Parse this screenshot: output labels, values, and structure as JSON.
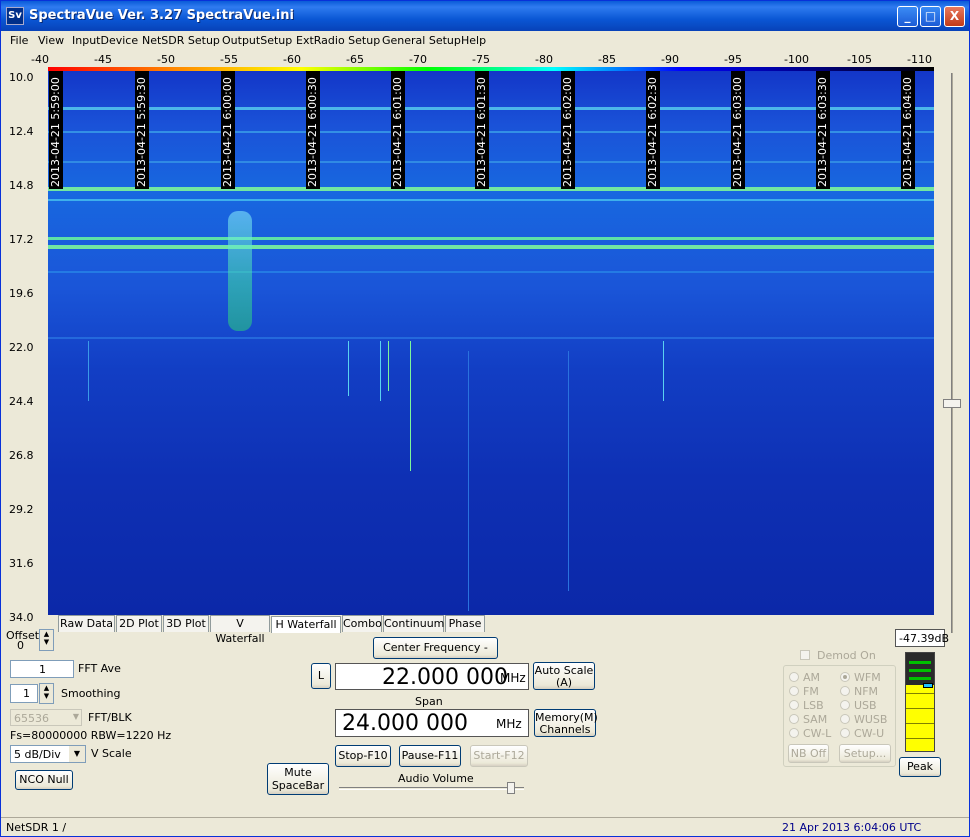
{
  "window": {
    "icon_text": "Sv",
    "title": "SpectraVue Ver. 3.27  SpectraVue.ini",
    "minimize": "_",
    "maximize": "□",
    "close": "X"
  },
  "menu": [
    "File",
    "View",
    "InputDevice",
    "NetSDR Setup",
    "OutputSetup",
    "ExtRadio Setup",
    "General Setup",
    "Help"
  ],
  "db_scale": [
    "-40",
    "-45",
    "-50",
    "-55",
    "-60",
    "-65",
    "-70",
    "-75",
    "-80",
    "-85",
    "-90",
    "-95",
    "-100",
    "-105",
    "-110"
  ],
  "freq_axis": [
    "10.0",
    "12.4",
    "14.8",
    "17.2",
    "19.6",
    "22.0",
    "24.4",
    "26.8",
    "29.2",
    "31.6",
    "34.0"
  ],
  "timestamps": [
    "2013-04-21 5:59:00",
    "2013-04-21 5:59:30",
    "2013-04-21 6:00:00",
    "2013-04-21 6:00:30",
    "2013-04-21 6:01:00",
    "2013-04-21 6:01:30",
    "2013-04-21 6:02:00",
    "2013-04-21 6:02:30",
    "2013-04-21 6:03:00",
    "2013-04-21 6:03:30",
    "2013-04-21 6:04:00"
  ],
  "tabs": [
    "Raw Data",
    "2D Plot",
    "3D Plot",
    "V Waterfall",
    "H Waterfall",
    "Combo",
    "Continuum",
    "Phase"
  ],
  "active_tab": "H Waterfall",
  "left_panel": {
    "offset_label": "Offset",
    "offset_value": "0",
    "fft_ave_value": "1",
    "fft_ave_label": "FFT Ave",
    "smoothing_value": "1",
    "smoothing_label": "Smoothing",
    "fft_blk_value": "65536",
    "fft_blk_label": "FFT/BLK",
    "fs_info": "Fs=80000000 RBW=1220 Hz",
    "vscale_value": "5 dB/Div",
    "vscale_label": "V Scale",
    "nco_null": "NCO Null"
  },
  "center": {
    "mute_line1": "Mute",
    "mute_line2": "SpaceBar",
    "center_freq_button": "Center Frequency - Ins",
    "l_button": "L",
    "center_freq_value": "22.000 000",
    "center_freq_unit": "MHz",
    "auto_scale_line1": "Auto Scale",
    "auto_scale_line2": "(A)",
    "span_label": "Span",
    "span_value": "24.000 000",
    "span_unit": "MHz",
    "memory_line1": "Memory(M)",
    "memory_line2": "Channels",
    "stop": "Stop-F10",
    "pause": "Pause-F11",
    "start": "Start-F12",
    "audio_volume": "Audio Volume"
  },
  "demod": {
    "demod_on": "Demod On",
    "modes_left": [
      "AM",
      "FM",
      "LSB",
      "SAM",
      "CW-L"
    ],
    "modes_right": [
      "WFM",
      "NFM",
      "USB",
      "WUSB",
      "CW-U"
    ],
    "selected": "WFM",
    "nb_off": "NB Off",
    "setup": "Setup..."
  },
  "meter": {
    "peak_value": "-47.39dB",
    "peak_button": "Peak"
  },
  "status": {
    "left": "NetSDR 1  /",
    "right": "21 Apr 2013  6:04:06 UTC"
  },
  "colors": {
    "title_blue": "#0a57d5",
    "waterfall_blue": "#1a52d8",
    "signal_green": "#7cf59a",
    "status_blue": "#00008b"
  }
}
